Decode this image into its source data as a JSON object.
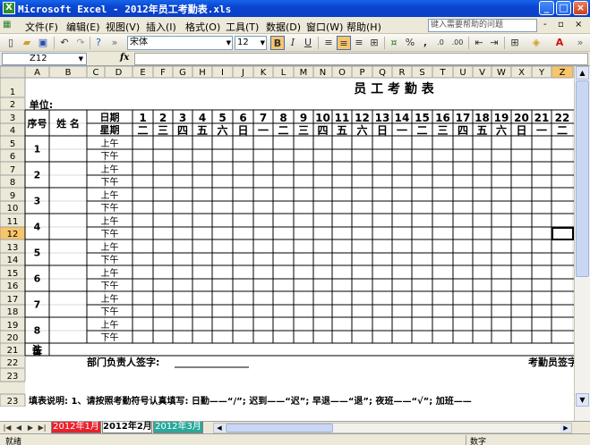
{
  "window": {
    "title": "Microsoft Excel - 2012年员工考勤表.xls",
    "app_icon": "X",
    "minimize": "_",
    "maximize": "□",
    "close": "×"
  },
  "menu": {
    "items": [
      "文件(F)",
      "编辑(E)",
      "视图(V)",
      "插入(I)",
      "格式(O)",
      "工具(T)",
      "数据(D)",
      "窗口(W)",
      "帮助(H)"
    ],
    "help_placeholder": "键入需要帮助的问题",
    "mdi_controls": [
      "-",
      "▫",
      "×"
    ]
  },
  "toolbar": {
    "font_name": "宋体",
    "font_size": "12",
    "bold": "B",
    "italic": "I",
    "underline": "U",
    "percent": "%",
    "comma": ","
  },
  "formula_bar": {
    "name_box": "Z12",
    "fx": "fx",
    "formula": ""
  },
  "columns": [
    "A",
    "B",
    "C",
    "D",
    "E",
    "F",
    "G",
    "H",
    "I",
    "J",
    "K",
    "L",
    "M",
    "N",
    "O",
    "P",
    "Q",
    "R",
    "S",
    "T",
    "U",
    "V",
    "W",
    "X",
    "Y",
    "Z"
  ],
  "rows": [
    "1",
    "2",
    "3",
    "4",
    "5",
    "6",
    "7",
    "8",
    "9",
    "10",
    "11",
    "12",
    "13",
    "14",
    "15",
    "16",
    "17",
    "18",
    "19",
    "20",
    "21",
    "22",
    "23"
  ],
  "selected_cell": {
    "col": "Z",
    "row": "12"
  },
  "sheet": {
    "title": "员 工 考 勤 表",
    "unit_label": "单位:",
    "header_seq": "序号",
    "header_name": "姓  名",
    "header_date": "日期",
    "header_week": "星期",
    "days": [
      "1",
      "2",
      "3",
      "4",
      "5",
      "6",
      "7",
      "8",
      "9",
      "10",
      "11",
      "12",
      "13",
      "14",
      "15",
      "16",
      "17",
      "18",
      "19",
      "20",
      "21",
      "22"
    ],
    "weekdays": [
      "二",
      "三",
      "四",
      "五",
      "六",
      "日",
      "一",
      "二",
      "三",
      "四",
      "五",
      "六",
      "日",
      "一",
      "二",
      "三",
      "四",
      "五",
      "六",
      "日",
      "一",
      "二"
    ],
    "employee_numbers": [
      "1",
      "2",
      "3",
      "4",
      "5",
      "6",
      "7",
      "8"
    ],
    "am": "上午",
    "pm": "下午",
    "remarks_1": "备",
    "remarks_2": "注",
    "manager_sign": "部门负责人签字:",
    "clerk_sign": "考勤员签字",
    "instructions": "填表说明: 1、请按照考勤符号认真填写: 日勤——“/”; 迟到——“迟”; 早退——“退”; 夜班——“√”; 加班——"
  },
  "tabs": [
    "2012年1月",
    "2012年2月",
    "2012年3月"
  ],
  "active_tab": "2012年2月",
  "status": {
    "ready": "就绪",
    "mode": "数字"
  },
  "colors": {
    "tab1": "#e8212b",
    "tab2": "#ffffff",
    "tab3": "#2aa89a",
    "header_bg": "#ece9d8",
    "selected_header": "#f7c56b"
  }
}
